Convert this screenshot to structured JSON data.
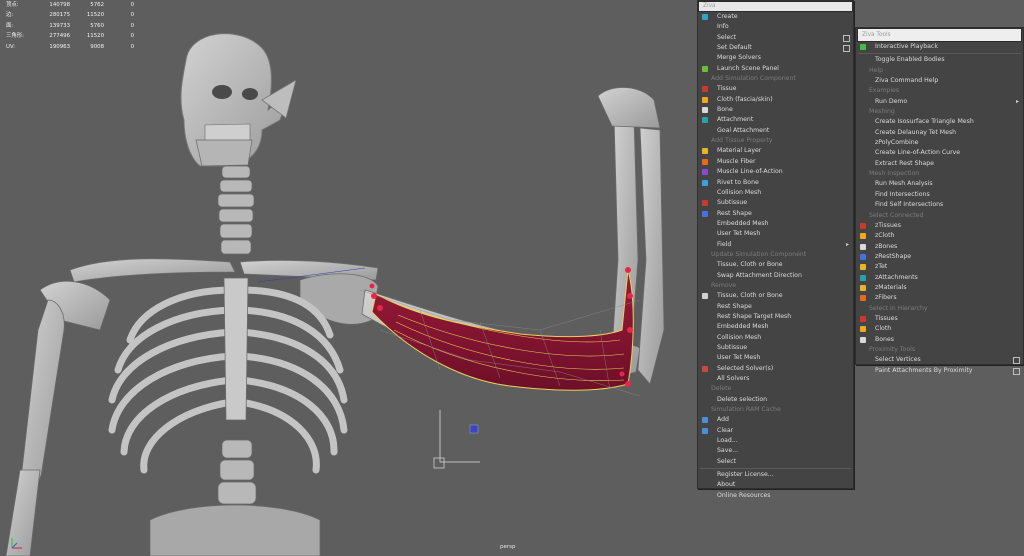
{
  "hud": {
    "rows": [
      {
        "label": "顶点:",
        "a": "140798",
        "b": "5762",
        "c": "0"
      },
      {
        "label": "边:",
        "a": "280175",
        "b": "11520",
        "c": "0"
      },
      {
        "label": "面:",
        "a": "139733",
        "b": "5760",
        "c": "0"
      },
      {
        "label": "三角形:",
        "a": "277496",
        "b": "11520",
        "c": "0"
      },
      {
        "label": "UV:",
        "a": "190963",
        "b": "9008",
        "c": "0"
      }
    ]
  },
  "camera_label": "persp",
  "ziva_menu": {
    "title": "Ziva",
    "items": [
      {
        "type": "item",
        "label": "Create",
        "icon": "ziva-logo-icon",
        "color": "#2fa3c8"
      },
      {
        "type": "item",
        "label": "Info"
      },
      {
        "type": "item",
        "label": "Select",
        "checkbox": true
      },
      {
        "type": "item",
        "label": "Set Default",
        "checkbox": true
      },
      {
        "type": "item",
        "label": "Merge Solvers"
      },
      {
        "type": "item",
        "label": "Launch Scene Panel",
        "icon": "scene-panel-icon",
        "color": "#6abf3a"
      },
      {
        "type": "header",
        "label": "Add Simulation Component"
      },
      {
        "type": "item",
        "label": "Tissue",
        "icon": "tissue-icon",
        "color": "#c83a2b"
      },
      {
        "type": "item",
        "label": "Cloth (fascia/skin)",
        "icon": "cloth-icon",
        "color": "#f0a81c"
      },
      {
        "type": "item",
        "label": "Bone",
        "icon": "bone-icon",
        "color": "#d9d9d9"
      },
      {
        "type": "item",
        "label": "Attachment",
        "icon": "attachment-icon",
        "color": "#2aa3a8"
      },
      {
        "type": "item",
        "label": "Goal Attachment"
      },
      {
        "type": "header",
        "label": "Add Tissue Property"
      },
      {
        "type": "item",
        "label": "Material Layer",
        "icon": "material-icon",
        "color": "#e6b52a"
      },
      {
        "type": "item",
        "label": "Muscle Fiber",
        "icon": "fiber-icon",
        "color": "#e46a1e"
      },
      {
        "type": "item",
        "label": "Muscle Line-of-Action",
        "icon": "line-of-action-icon",
        "color": "#8a4bd0"
      },
      {
        "type": "item",
        "label": "Rivet to Bone",
        "icon": "rivet-icon",
        "color": "#3ba0e0"
      },
      {
        "type": "item",
        "label": "Collision Mesh"
      },
      {
        "type": "item",
        "label": "Subtissue",
        "icon": "subtissue-icon",
        "color": "#c83a2b"
      },
      {
        "type": "item",
        "label": "Rest Shape",
        "icon": "rest-shape-icon",
        "color": "#4a6fe0"
      },
      {
        "type": "item",
        "label": "Embedded Mesh"
      },
      {
        "type": "item",
        "label": "User Tet Mesh"
      },
      {
        "type": "item",
        "label": "Field",
        "submenu": true
      },
      {
        "type": "header",
        "label": "Update Simulation Component"
      },
      {
        "type": "item",
        "label": "Tissue, Cloth or Bone"
      },
      {
        "type": "item",
        "label": "Swap Attachment Direction"
      },
      {
        "type": "header",
        "label": "Remove"
      },
      {
        "type": "item",
        "label": "Tissue, Cloth or Bone",
        "icon": "remove-icon",
        "color": "#d0d0d0"
      },
      {
        "type": "item",
        "label": "Rest Shape"
      },
      {
        "type": "item",
        "label": "Rest Shape Target Mesh"
      },
      {
        "type": "item",
        "label": "Embedded Mesh"
      },
      {
        "type": "item",
        "label": "Collision Mesh"
      },
      {
        "type": "item",
        "label": "Subtissue"
      },
      {
        "type": "item",
        "label": "User Tet Mesh"
      },
      {
        "type": "item",
        "label": "Selected Solver(s)",
        "icon": "solver-icon",
        "color": "#c84a3a"
      },
      {
        "type": "item",
        "label": "All Solvers"
      },
      {
        "type": "header",
        "label": "Delete"
      },
      {
        "type": "item",
        "label": "Delete selection"
      },
      {
        "type": "header",
        "label": "Simulation RAM Cache"
      },
      {
        "type": "item",
        "label": "Add",
        "icon": "cache-add-icon",
        "color": "#4a8fd8"
      },
      {
        "type": "item",
        "label": "Clear",
        "icon": "cache-clear-icon",
        "color": "#4a8fd8"
      },
      {
        "type": "item",
        "label": "Load..."
      },
      {
        "type": "item",
        "label": "Save..."
      },
      {
        "type": "item",
        "label": "Select"
      },
      {
        "type": "separator"
      },
      {
        "type": "item",
        "label": "Register License..."
      },
      {
        "type": "item",
        "label": "About"
      },
      {
        "type": "item",
        "label": "Online Resources"
      }
    ]
  },
  "ziva_tools": {
    "title": "Ziva Tools",
    "items": [
      {
        "type": "item",
        "label": "Interactive Playback",
        "icon": "play-icon",
        "color": "#3fc13f"
      },
      {
        "type": "separator"
      },
      {
        "type": "item",
        "label": "Toggle Enabled Bodies"
      },
      {
        "type": "header",
        "label": "Help"
      },
      {
        "type": "item",
        "label": "Ziva Command Help"
      },
      {
        "type": "header",
        "label": "Examples"
      },
      {
        "type": "item",
        "label": "Run Demo",
        "submenu": true
      },
      {
        "type": "header",
        "label": "Meshing"
      },
      {
        "type": "item",
        "label": "Create Isosurface Triangle Mesh"
      },
      {
        "type": "item",
        "label": "Create Delaunay Tet Mesh"
      },
      {
        "type": "item",
        "label": "zPolyCombine"
      },
      {
        "type": "item",
        "label": "Create Line-of-Action Curve"
      },
      {
        "type": "item",
        "label": "Extract Rest Shape"
      },
      {
        "type": "header",
        "label": "Mesh Inspection"
      },
      {
        "type": "item",
        "label": "Run Mesh Analysis"
      },
      {
        "type": "item",
        "label": "Find Intersections"
      },
      {
        "type": "item",
        "label": "Find Self Intersections"
      },
      {
        "type": "header",
        "label": "Select Connected"
      },
      {
        "type": "item",
        "label": "zTissues",
        "icon": "tissue-icon",
        "color": "#c83a2b"
      },
      {
        "type": "item",
        "label": "zCloth",
        "icon": "cloth-icon",
        "color": "#f0a81c"
      },
      {
        "type": "item",
        "label": "zBones",
        "icon": "bone-icon",
        "color": "#d9d9d9"
      },
      {
        "type": "item",
        "label": "zRestShape",
        "icon": "rest-shape-icon",
        "color": "#4a6fe0"
      },
      {
        "type": "item",
        "label": "zTet",
        "icon": "tet-icon",
        "color": "#e6b52a"
      },
      {
        "type": "item",
        "label": "zAttachments",
        "icon": "attachment-icon",
        "color": "#2aa3a8"
      },
      {
        "type": "item",
        "label": "zMaterials",
        "icon": "material-icon",
        "color": "#e6b52a"
      },
      {
        "type": "item",
        "label": "zFibers",
        "icon": "fiber-icon",
        "color": "#e46a1e"
      },
      {
        "type": "header",
        "label": "Select in Hierarchy"
      },
      {
        "type": "item",
        "label": "Tissues",
        "icon": "tissue-icon",
        "color": "#c83a2b"
      },
      {
        "type": "item",
        "label": "Cloth",
        "icon": "cloth-icon",
        "color": "#f0a81c"
      },
      {
        "type": "item",
        "label": "Bones",
        "icon": "bone-icon",
        "color": "#d9d9d9"
      },
      {
        "type": "header",
        "label": "Proximity Tools"
      },
      {
        "type": "item",
        "label": "Select Vertices",
        "checkbox": true
      },
      {
        "type": "item",
        "label": "Paint Attachments By Proximity",
        "checkbox": true
      }
    ]
  }
}
